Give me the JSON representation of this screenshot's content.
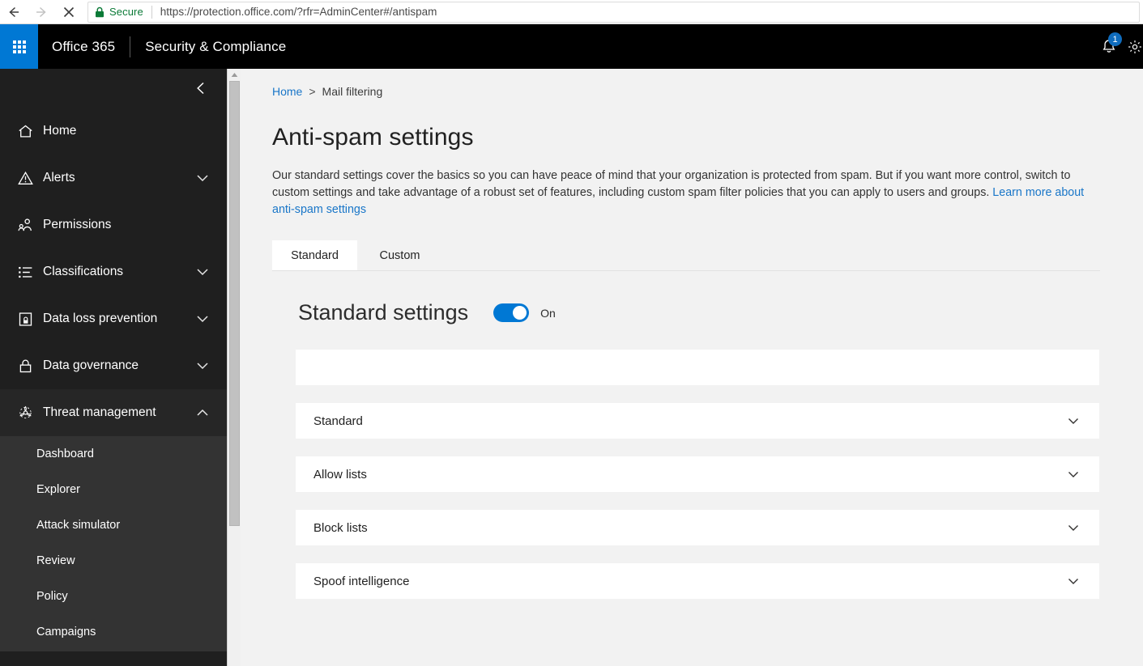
{
  "browser": {
    "back_icon": "arrow-left-icon",
    "forward_icon": "arrow-right-icon",
    "stop_icon": "close-icon",
    "security_label": "Secure",
    "lock_icon": "lock-icon",
    "url": "https://protection.office.com/?rfr=AdminCenter#/antispam"
  },
  "header": {
    "waffle_icon": "app-launcher-icon",
    "brand": "Office 365",
    "app_name": "Security & Compliance",
    "notifications_icon": "bell-icon",
    "notifications_count": "1",
    "settings_icon": "gear-icon",
    "accent": "#0078d4"
  },
  "sidebar": {
    "collapse_icon": "chevron-left-icon",
    "items": [
      {
        "label": "Home",
        "icon": "home-icon",
        "chevron": ""
      },
      {
        "label": "Alerts",
        "icon": "alert-triangle-icon",
        "chevron": "chevron-down-icon"
      },
      {
        "label": "Permissions",
        "icon": "people-icon",
        "chevron": ""
      },
      {
        "label": "Classifications",
        "icon": "list-icon",
        "chevron": "chevron-down-icon"
      },
      {
        "label": "Data loss prevention",
        "icon": "document-lock-icon",
        "chevron": "chevron-down-icon"
      },
      {
        "label": "Data governance",
        "icon": "lock-icon",
        "chevron": "chevron-down-icon"
      },
      {
        "label": "Threat management",
        "icon": "biohazard-icon",
        "chevron": "chevron-up-icon"
      }
    ],
    "submenu": [
      {
        "label": "Dashboard"
      },
      {
        "label": "Explorer"
      },
      {
        "label": "Attack simulator"
      },
      {
        "label": "Review"
      },
      {
        "label": "Policy"
      },
      {
        "label": "Campaigns"
      }
    ]
  },
  "main": {
    "breadcrumb": {
      "home": "Home",
      "separator": ">",
      "current": "Mail filtering"
    },
    "title": "Anti-spam settings",
    "description": "Our standard settings cover the basics so you can have peace of mind that your organization is protected from spam. But if you want more control, switch to custom settings and take advantage of a robust set of features, including custom spam filter policies that you can apply to users and groups. ",
    "description_link": "Learn more about anti-spam settings",
    "tabs": [
      {
        "label": "Standard",
        "active": true
      },
      {
        "label": "Custom",
        "active": false
      }
    ],
    "settings_heading": "Standard settings",
    "toggle_state": "On",
    "panels": [
      {
        "label": "",
        "chevron": ""
      },
      {
        "label": "Standard",
        "chevron": "chevron-down-icon"
      },
      {
        "label": "Allow lists",
        "chevron": "chevron-down-icon"
      },
      {
        "label": "Block lists",
        "chevron": "chevron-down-icon"
      },
      {
        "label": "Spoof intelligence",
        "chevron": "chevron-down-icon"
      }
    ]
  },
  "scrollbar": {
    "up_arrow_icon": "caret-up-icon"
  }
}
